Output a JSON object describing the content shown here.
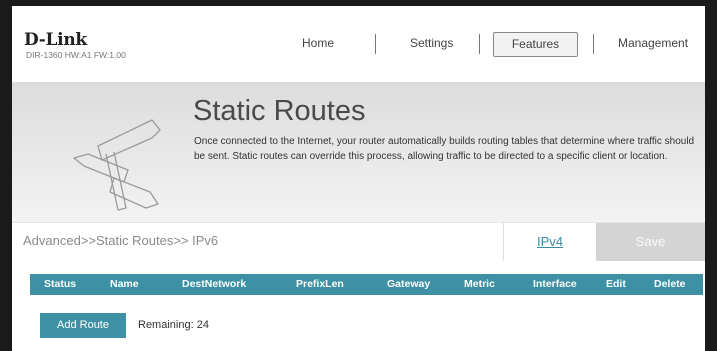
{
  "header": {
    "logo": "D-Link",
    "model": "DIR-1360 HW:A1 FW:1.00",
    "nav": [
      "Home",
      "Settings",
      "Features",
      "Management"
    ],
    "active_tab": "Features"
  },
  "banner": {
    "title": "Static Routes",
    "description": "Once connected to the Internet, your router automatically builds routing tables that determine where traffic should be sent. Static routes can override this process, allowing traffic to be directed to a specific client or location."
  },
  "breadcrumb": "Advanced>>Static Routes>> IPv6",
  "ipv4_link": "IPv4",
  "save_label": "Save",
  "table": {
    "columns": [
      "Status",
      "Name",
      "DestNetwork",
      "PrefixLen",
      "Gateway",
      "Metric",
      "Interface",
      "Edit",
      "Delete"
    ]
  },
  "add_route_label": "Add Route",
  "remaining": "Remaining: 24",
  "colors": {
    "accent": "#3e91a4",
    "link": "#3a8aa6",
    "save_disabled": "#d4d4d4"
  }
}
